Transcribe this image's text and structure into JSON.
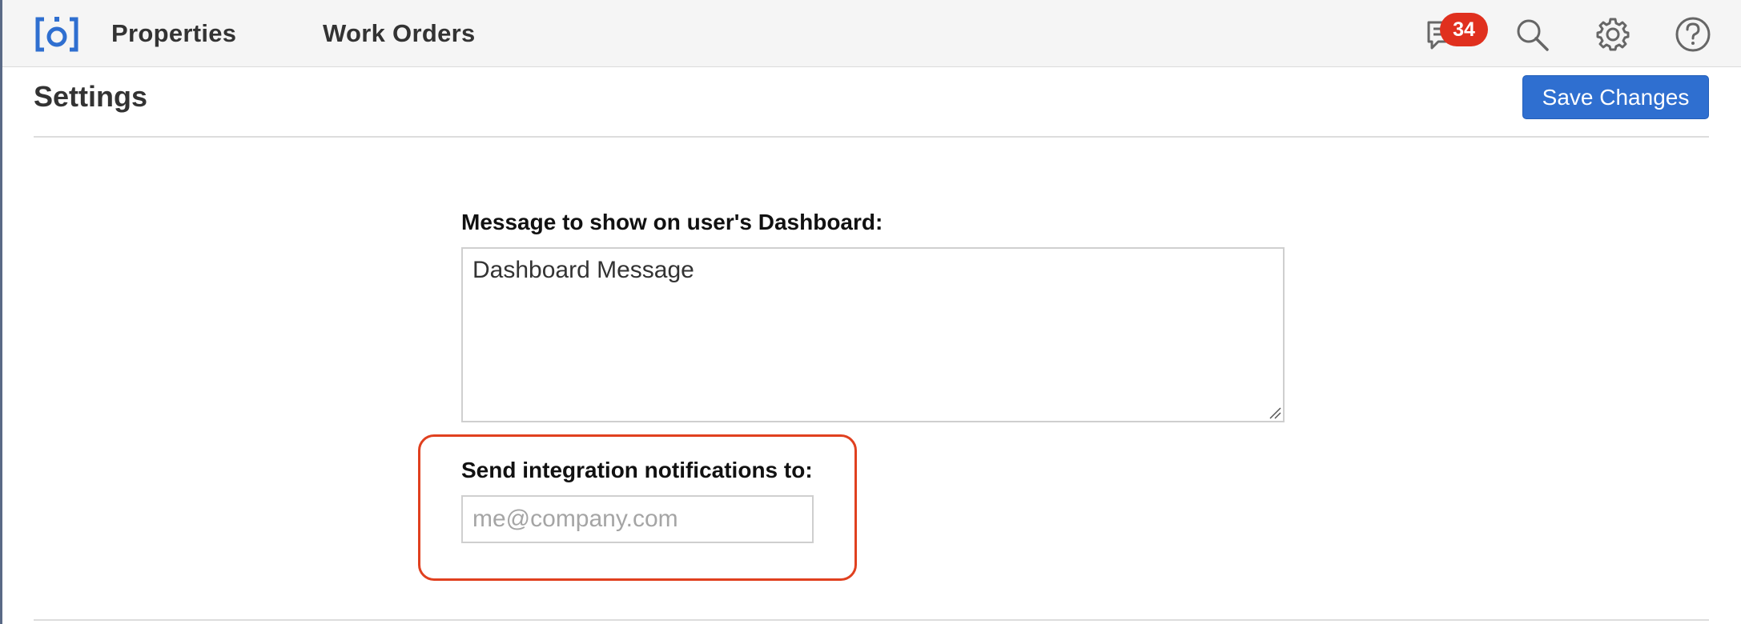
{
  "header": {
    "logo_icon": "brand-logo-icon",
    "nav": [
      {
        "label": "Properties"
      },
      {
        "label": "Work Orders"
      }
    ],
    "icons": {
      "messages": "messages-icon",
      "search": "search-icon",
      "settings": "gear-icon",
      "help": "help-icon"
    },
    "messages_badge": "34"
  },
  "page": {
    "title": "Settings",
    "save_label": "Save Changes"
  },
  "form": {
    "dashboard_message": {
      "label": "Message to show on user's Dashboard:",
      "value": "Dashboard Message"
    },
    "integration_email": {
      "label": "Send integration notifications to:",
      "value": "",
      "placeholder": "me@company.com"
    }
  },
  "colors": {
    "accent": "#2f6fd0",
    "badge": "#e0301e",
    "highlight": "#e0401f",
    "logo": "#2f6fd0"
  }
}
